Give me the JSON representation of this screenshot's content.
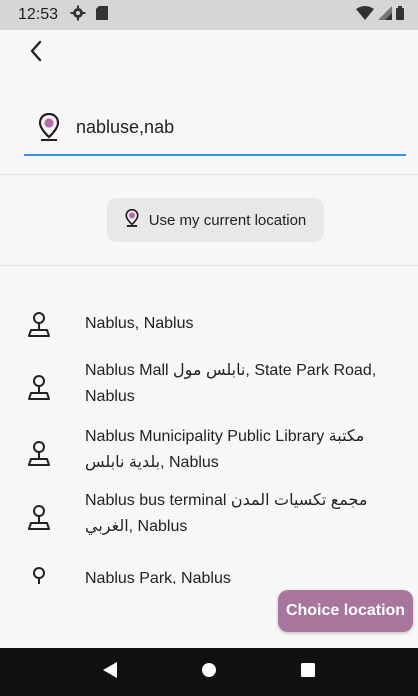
{
  "status_bar": {
    "time": "12:53",
    "icons": [
      "gear-icon",
      "sim-card-icon"
    ],
    "right_icons": [
      "wifi-icon",
      "signal-icon",
      "battery-icon"
    ]
  },
  "search": {
    "value": "nabluse,nab",
    "icon": "location-pin-icon",
    "underline_color": "#3a8fd6"
  },
  "current_location": {
    "label": "Use my current location",
    "icon": "location-pin-icon"
  },
  "results": [
    {
      "icon": "map-pin-icon",
      "text": "Nablus, Nablus"
    },
    {
      "icon": "map-pin-icon",
      "text": "Nablus Mall نابلس مول, State Park Road, Nablus"
    },
    {
      "icon": "map-pin-icon",
      "text": "Nablus Municipality Public Library مكتبة بلدية نابلس, Nablus"
    },
    {
      "icon": "map-pin-icon",
      "text": "Nablus bus terminal مجمع تكسيات المدن الغربي, Nablus"
    },
    {
      "icon": "map-pin-icon",
      "text": "Nablus Park, Nablus"
    }
  ],
  "choice_button": {
    "label": "Choice location",
    "color": "#a8769d"
  },
  "nav": [
    "back-triangle-icon",
    "home-circle-icon",
    "recents-square-icon"
  ]
}
